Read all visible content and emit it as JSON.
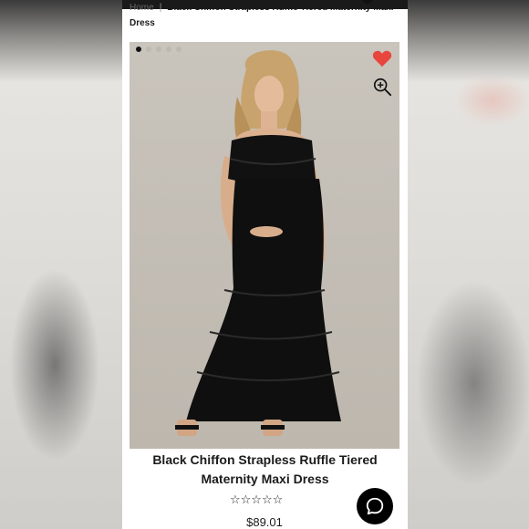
{
  "breadcrumb": {
    "home": "Home",
    "separator": "|",
    "current": "Black Chiffon Strapless Ruffle Tiered Maternity Maxi Dress"
  },
  "gallery": {
    "slide_count": 5,
    "active_slide": 1,
    "favorite_icon": "heart-icon",
    "favorite_color": "#e8453c",
    "zoom_icon": "zoom-in-icon"
  },
  "product": {
    "title": "Black Chiffon Strapless Ruffle Tiered Maternity Maxi Dress",
    "rating_stars": "☆☆☆☆☆",
    "rating_value": 0,
    "price": "$89.01"
  },
  "chat": {
    "icon": "chat-bubble-icon",
    "color": "#000000"
  }
}
